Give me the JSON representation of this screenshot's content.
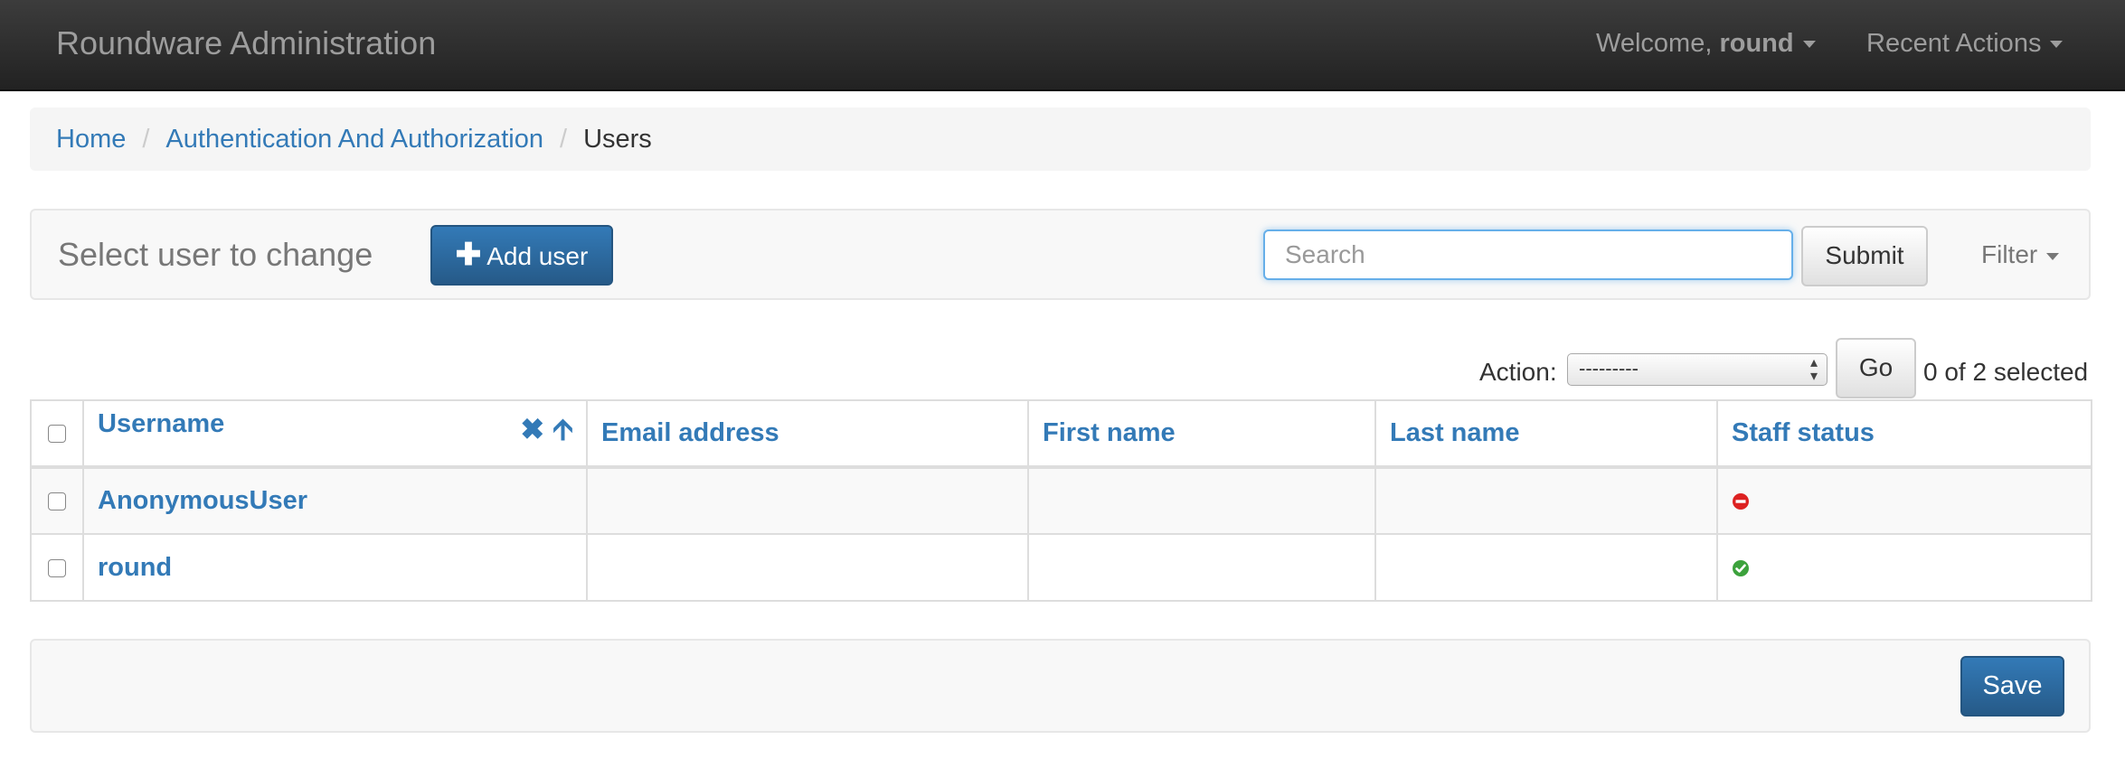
{
  "navbar": {
    "brand": "Roundware Administration",
    "welcome_prefix": "Welcome, ",
    "username": "round",
    "recent_actions": "Recent Actions"
  },
  "breadcrumb": {
    "items": [
      "Home",
      "Authentication And Authorization"
    ],
    "current": "Users",
    "separator": "/"
  },
  "toolbar": {
    "heading": "Select user to change",
    "add_label": "Add user",
    "search_placeholder": "Search",
    "submit_label": "Submit",
    "filter_label": "Filter"
  },
  "actions": {
    "label": "Action:",
    "selected_option": "---------",
    "go_label": "Go",
    "selected_count": "0 of 2 selected"
  },
  "table": {
    "columns": [
      "Username",
      "Email address",
      "First name",
      "Last name",
      "Staff status"
    ],
    "rows": [
      {
        "username": "AnonymousUser",
        "email": "",
        "first_name": "",
        "last_name": "",
        "staff_status": false
      },
      {
        "username": "round",
        "email": "",
        "first_name": "",
        "last_name": "",
        "staff_status": true
      }
    ]
  },
  "footer": {
    "save_label": "Save"
  },
  "colors": {
    "link": "#337ab7",
    "primary_button": "#286090",
    "status_yes": "#3ca23c",
    "status_no": "#dd2222"
  },
  "icons": {
    "add": "plus-icon",
    "sort_remove": "close-icon",
    "sort_direction": "arrow-up-icon",
    "status_no": "no-entry-icon",
    "status_yes": "check-circle-icon"
  }
}
